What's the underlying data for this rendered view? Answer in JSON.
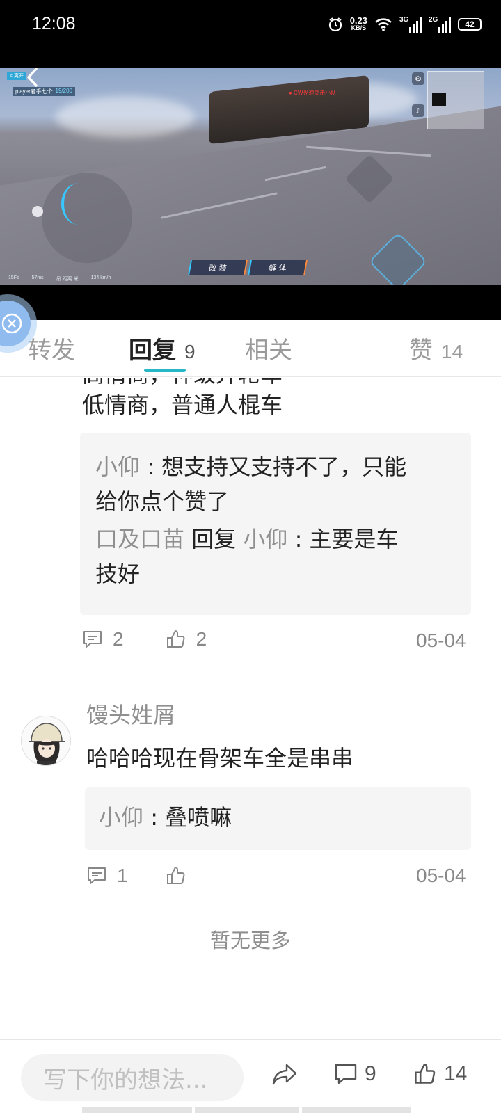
{
  "status_bar": {
    "time": "12:08",
    "net_speed_value": "0.23",
    "net_speed_unit": "KB/S",
    "signal1_label": "3G",
    "signal2_label": "2G",
    "battery": "42"
  },
  "video": {
    "hud_top_tag": "< 离开",
    "hud_player": "player者手七个",
    "hud_count": "19/200",
    "red_tag": "● CW光速突击小队",
    "action_buttons": [
      "改 装",
      "解 体"
    ],
    "bottom_hud": [
      "15Fs",
      "57ms",
      "吊 距离 米",
      "134 km/h"
    ]
  },
  "tabs": [
    {
      "label": "转发",
      "count": ""
    },
    {
      "label": "回复",
      "count": "9"
    },
    {
      "label": "相关",
      "count": ""
    },
    {
      "label": "赞",
      "count": "14"
    }
  ],
  "comments": {
    "partial_top_line": "高情商，神级弄轮车",
    "partial_line": "低情商，普通人棍车",
    "c1_replies": {
      "r1_name": "小仰",
      "r1_colon": " : ",
      "r1_text_line1": "想支持又支持不了，只能",
      "r1_text_line2": "给你点个赞了",
      "r2_name": "口及口苗",
      "r2_reply_word": " 回复 ",
      "r2_target": "小仰",
      "r2_colon": " : ",
      "r2_text_line1": "主要是车",
      "r2_text_line2": "技好"
    },
    "c1_comment_count": "2",
    "c1_like_count": "2",
    "c1_date": "05-04",
    "c2_username": "馒头姓屑",
    "c2_text": "哈哈哈现在骨架车全是串串",
    "c2_reply_name": "小仰",
    "c2_reply_colon": " : ",
    "c2_reply_text": "叠喷嘛",
    "c2_comment_count": "1",
    "c2_like_count": "",
    "c2_date": "05-04",
    "no_more": "暂无更多"
  },
  "bottom_bar": {
    "input_placeholder": "写下你的想法...",
    "comment_count": "9",
    "like_count": "14"
  },
  "colors": {
    "accent": "#27b8c8",
    "muted_text": "#8f8f8f",
    "reply_bg": "#f5f5f5"
  }
}
